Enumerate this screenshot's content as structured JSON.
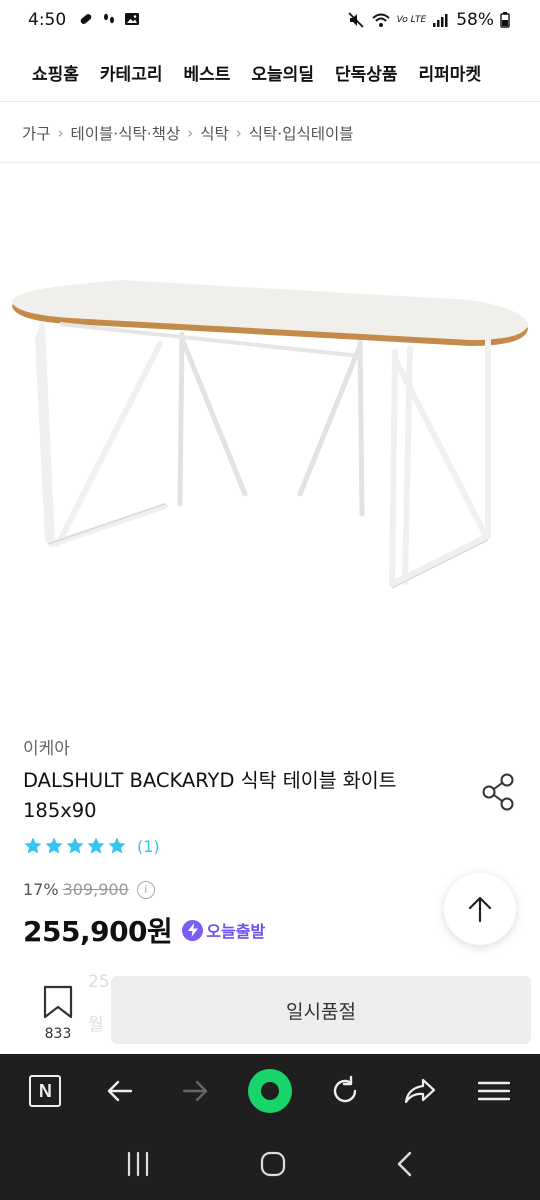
{
  "status_bar": {
    "time": "4:50",
    "battery": "58%",
    "network": "Vo LTE"
  },
  "top_nav": {
    "items": [
      "쇼핑홈",
      "카테고리",
      "베스트",
      "오늘의딜",
      "단독상품",
      "리퍼마켓"
    ]
  },
  "breadcrumb": [
    "가구",
    "테이블·식탁·책상",
    "식탁",
    "식탁·입식테이블"
  ],
  "product": {
    "brand": "이케아",
    "title": "DALSHULT BACKARYD 식탁 테이블 화이트 185x90",
    "rating_stars": 5,
    "review_count": "(1)",
    "discount": "17%",
    "original_price": "309,900",
    "price": "255,900원",
    "delivery_badge": "오늘출발",
    "image_icon": "oval-dining-table-image"
  },
  "action_bar": {
    "bookmark_count": "833",
    "soldout_label": "일시품절",
    "hidden_text_1": "25",
    "hidden_text_2": "월"
  },
  "colors": {
    "accent_blue": "#35c5f0",
    "delivery_purple": "#6b4ff0",
    "browser_bar": "#1f1f1f",
    "green": "#19d36b"
  },
  "browser_bar": {
    "n_label": "N"
  }
}
